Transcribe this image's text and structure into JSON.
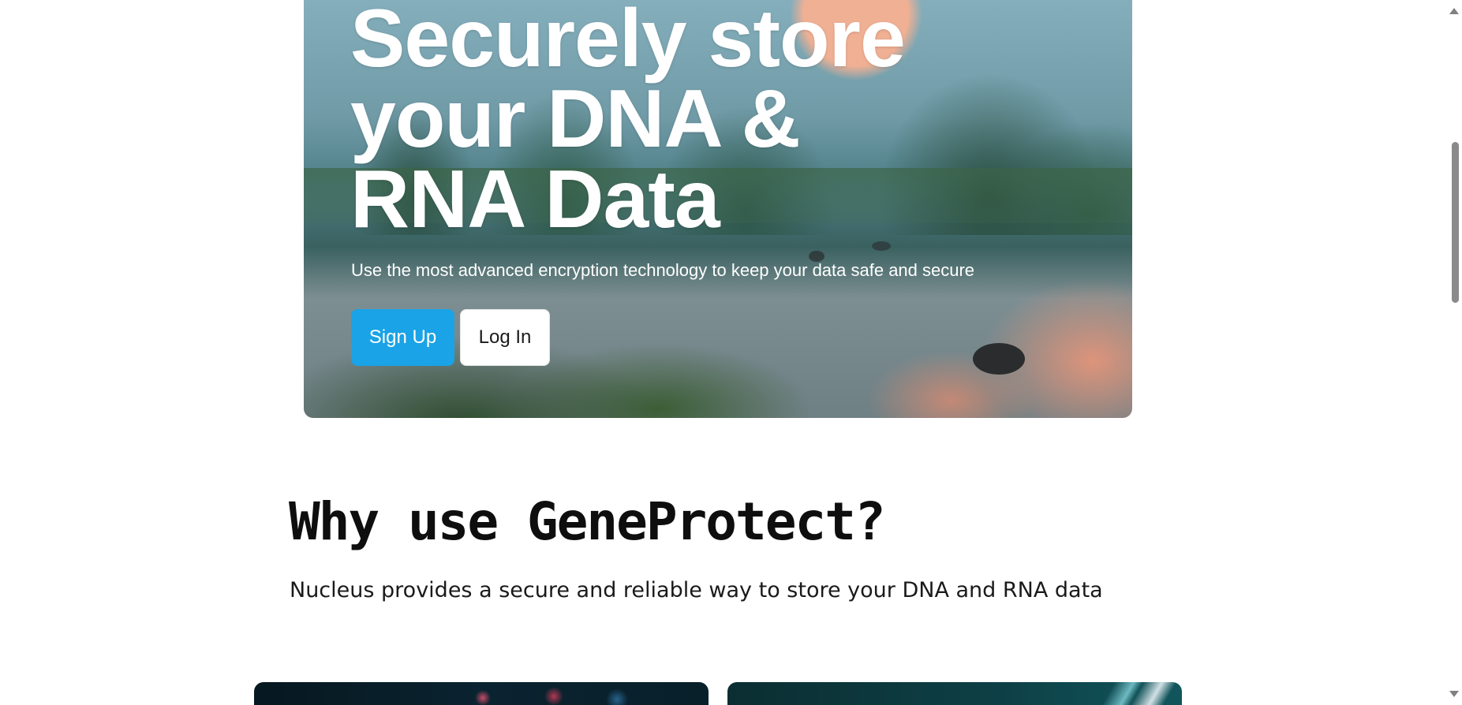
{
  "hero": {
    "title": "Securely store your DNA & RNA Data",
    "subtitle": "Use the most advanced encryption technology to keep your data safe and secure",
    "signup_label": "Sign Up",
    "login_label": "Log In"
  },
  "why": {
    "title": "Why use GeneProtect?",
    "text": "Nucleus provides a secure and reliable way to store your DNA and RNA data"
  },
  "colors": {
    "primary_button": "#1aa3e6",
    "heading": "#0e0e0e"
  }
}
